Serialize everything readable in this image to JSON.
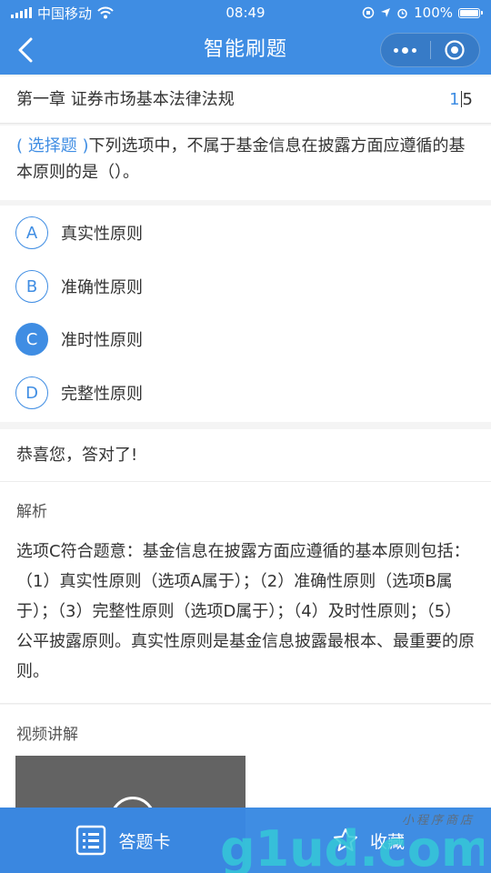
{
  "status_bar": {
    "carrier": "中国移动",
    "time": "08:49",
    "battery": "100%"
  },
  "nav": {
    "title": "智能刷题"
  },
  "chapter": {
    "title": "第一章 证券市场基本法律法规",
    "current": "1",
    "total": "5"
  },
  "question": {
    "type": "( 选择题 )",
    "text": "下列选项中，不属于基金信息在披露方面应遵循的基本原则的是（）。"
  },
  "options": [
    {
      "letter": "A",
      "text": "真实性原则",
      "selected": false
    },
    {
      "letter": "B",
      "text": "准确性原则",
      "selected": false
    },
    {
      "letter": "C",
      "text": "准时性原则",
      "selected": true
    },
    {
      "letter": "D",
      "text": "完整性原则",
      "selected": false
    }
  ],
  "result": {
    "text": "恭喜您，答对了!"
  },
  "analysis": {
    "label": "解析",
    "body": "选项C符合题意：基金信息在披露方面应遵循的基本原则包括：（1）真实性原则（选项A属于）；（2）准确性原则（选项B属于）；（3）完整性原则（选项D属于）；（4）及时性原则；（5）公平披露原则。真实性原则是基金信息披露最根本、最重要的原则。"
  },
  "video": {
    "label": "视频讲解"
  },
  "bottom_bar": {
    "answer_sheet": "答题卡",
    "favorite": "收藏"
  },
  "watermark": {
    "text": "g1ud.com",
    "subtext": "小程序商店"
  },
  "colors": {
    "accent": "#3f8de3",
    "watermark": "#35c8d8"
  }
}
